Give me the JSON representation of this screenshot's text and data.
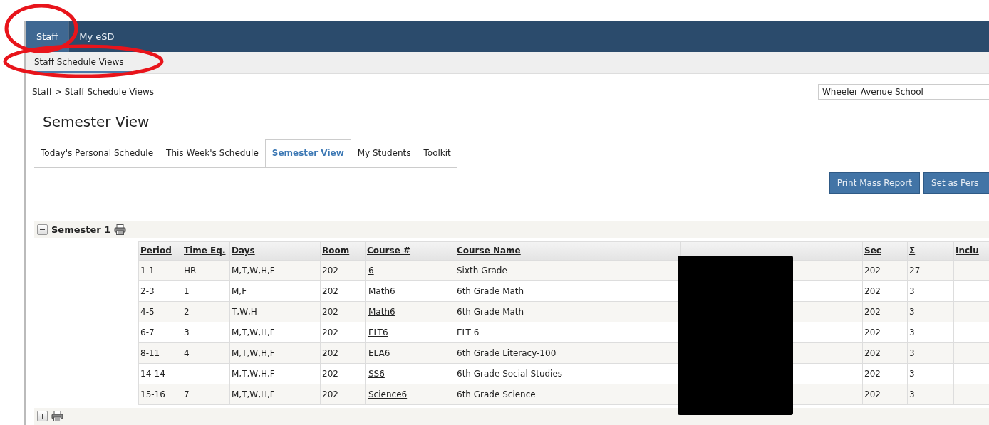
{
  "top_nav": [
    {
      "label": "Staff",
      "selected": true
    },
    {
      "label": "My eSD",
      "selected": false
    }
  ],
  "sub_nav": [
    {
      "label": "Staff Schedule Views",
      "selected": true
    }
  ],
  "breadcrumb": "Staff > Staff Schedule Views",
  "school_select": {
    "value": "Wheeler Avenue School"
  },
  "page_title": "Semester View",
  "tabs": [
    {
      "label": "Today's Personal Schedule",
      "selected": false
    },
    {
      "label": "This Week's Schedule",
      "selected": false
    },
    {
      "label": "Semester View",
      "selected": true
    },
    {
      "label": "My Students",
      "selected": false
    },
    {
      "label": "Toolkit",
      "selected": false
    }
  ],
  "buttons": [
    "Print Mass Report",
    "Set as Pers"
  ],
  "sections": [
    {
      "title": "Semester 1",
      "expanded": true,
      "table": {
        "columns": [
          "Period",
          "Time Eq.",
          "Days",
          "Room",
          "Course #",
          "Course Name",
          "Sec",
          "Σ",
          "Inclu"
        ],
        "rows": [
          {
            "period": "1-1",
            "time_eq": "HR",
            "days": "M,T,W,H,F",
            "room": "202",
            "course": "6",
            "course_name": "Sixth Grade",
            "sec": "202",
            "count": "27"
          },
          {
            "period": "2-3",
            "time_eq": "1",
            "days": "M,F",
            "room": "202",
            "course": "Math6",
            "course_name": "6th Grade Math",
            "sec": "202",
            "count": "3"
          },
          {
            "period": "4-5",
            "time_eq": "2",
            "days": "T,W,H",
            "room": "202",
            "course": "Math6",
            "course_name": "6th Grade Math",
            "sec": "202",
            "count": "3"
          },
          {
            "period": "6-7",
            "time_eq": "3",
            "days": "M,T,W,H,F",
            "room": "202",
            "course": "ELT6",
            "course_name": "ELT 6",
            "sec": "202",
            "count": "3"
          },
          {
            "period": "8-11",
            "time_eq": "4",
            "days": "M,T,W,H,F",
            "room": "202",
            "course": "ELA6",
            "course_name": "6th Grade Literacy-100",
            "sec": "202",
            "count": "3"
          },
          {
            "period": "14-14",
            "days": "M,T,W,H,F",
            "room": "202",
            "course": "SS6",
            "course_name": "6th Grade Social Studies",
            "sec": "202",
            "count": "3"
          },
          {
            "period": "15-16",
            "time_eq": "7",
            "days": "M,T,W,H,F",
            "room": "202",
            "course": "Science6",
            "course_name": "6th Grade Science",
            "sec": "202",
            "count": "3"
          }
        ]
      }
    },
    {
      "expanded": false
    }
  ]
}
